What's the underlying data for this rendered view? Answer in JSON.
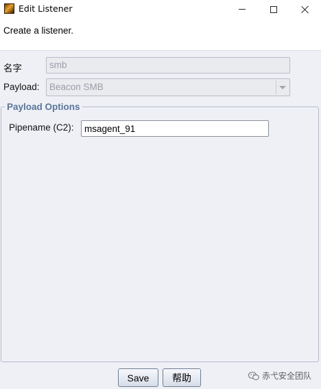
{
  "window": {
    "title": "Edit Listener"
  },
  "header": {
    "message": "Create a listener."
  },
  "form": {
    "name_label": "名字",
    "name_value": "smb",
    "payload_label": "Payload:",
    "payload_value": "Beacon SMB"
  },
  "payload_options": {
    "title": "Payload Options",
    "pipename_label": "Pipename (C2):",
    "pipename_value": "msagent_91"
  },
  "buttons": {
    "save": "Save",
    "help": "帮助"
  },
  "watermark": {
    "text": "赤弋安全团队"
  }
}
